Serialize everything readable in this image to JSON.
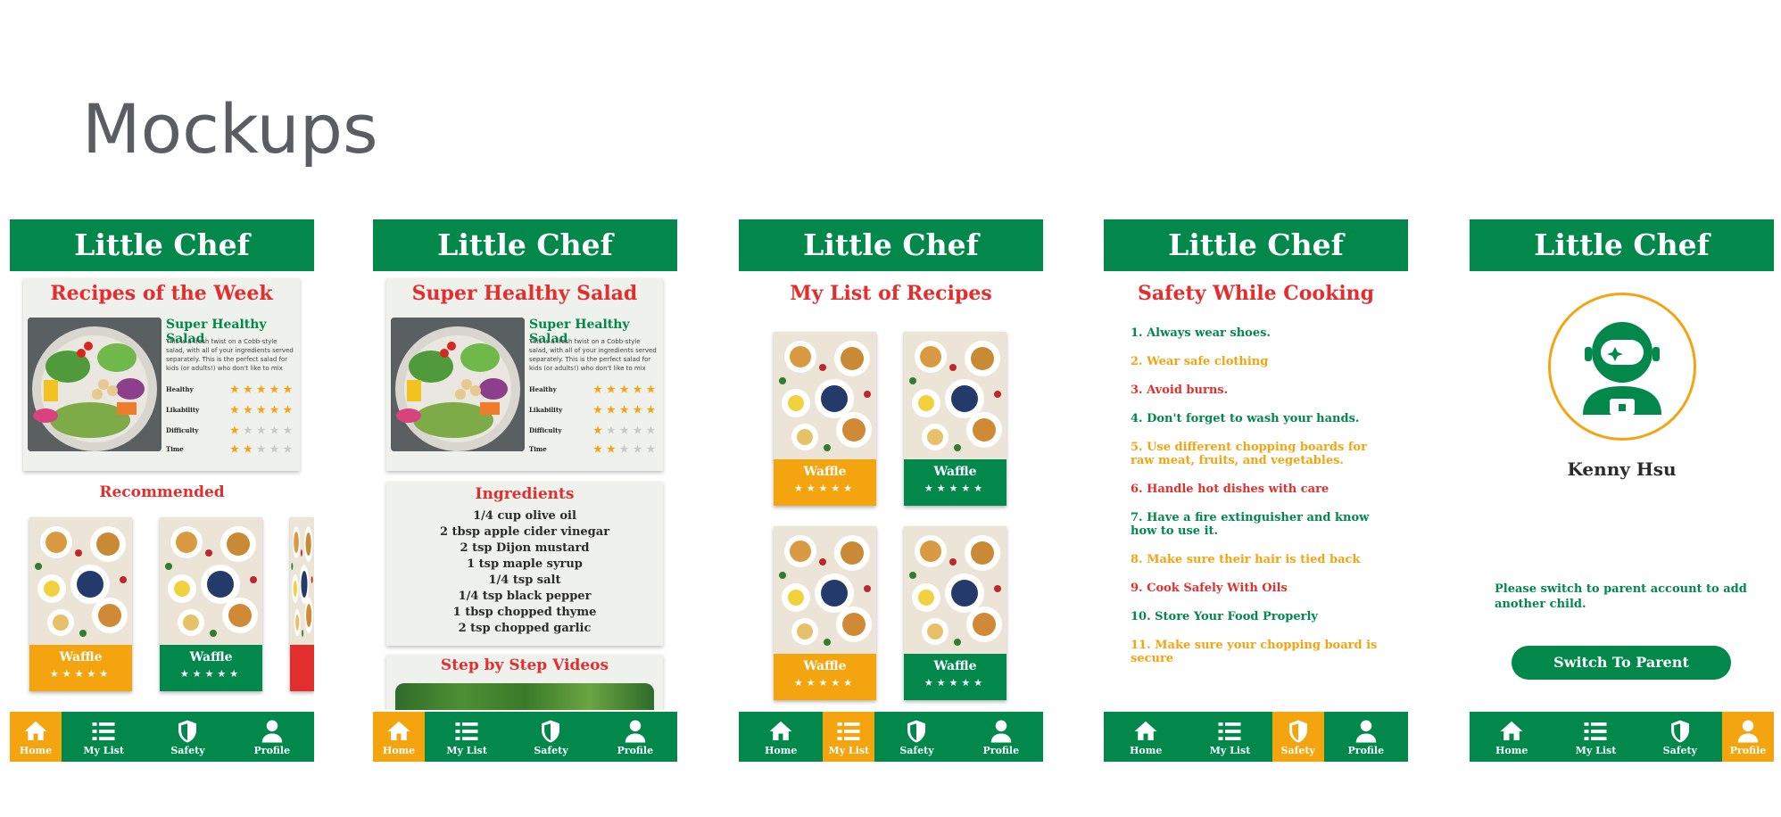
{
  "page": {
    "title": "Mockups"
  },
  "app": {
    "name": "Little Chef"
  },
  "colors": {
    "brand_green": "#01884a",
    "accent_orange": "#f4a40f",
    "title_red": "#e32e2e",
    "card_bg": "#eef1ec"
  },
  "nav": {
    "home": "Home",
    "list": "My List",
    "safety": "Safety",
    "profile": "Profile"
  },
  "screen1": {
    "heading": "Recipes of the Week",
    "recipe_name": "Super Healthy Salad",
    "recipe_desc": "This is a fresh twist on a Cobb-style salad, with all of your ingredients served separately. This is the perfect salad for kids (or adults!) who don't like to mix their",
    "ratings": [
      {
        "label": "Healthy",
        "value": 5
      },
      {
        "label": "Likability",
        "value": 5
      },
      {
        "label": "Difficulty",
        "value": 1
      },
      {
        "label": "Time",
        "value": 2
      }
    ],
    "recommended": "Recommended",
    "cards": [
      {
        "name": "Waffle",
        "stars": "★★★★★",
        "color": "#f4a40f"
      },
      {
        "name": "Waffle",
        "stars": "★★★★★",
        "color": "#01884a"
      }
    ]
  },
  "screen2": {
    "heading": "Super Healthy Salad",
    "recipe_name": "Super Healthy Salad",
    "recipe_desc": "This is a fresh twist on a Cobb-style salad, with all of your ingredients served separately. This is the perfect salad for kids (or adults!) who don't like to mix their",
    "ratings": [
      {
        "label": "Healthy",
        "value": 5
      },
      {
        "label": "Likability",
        "value": 5
      },
      {
        "label": "Difficulty",
        "value": 1
      },
      {
        "label": "Time",
        "value": 2
      }
    ],
    "ingredients_title": "Ingredients",
    "ingredients": [
      "1/4 cup olive oil",
      "2 tbsp apple cider vinegar",
      "2 tsp Dijon mustard",
      "1 tsp maple syrup",
      "1/4 tsp salt",
      "1/4 tsp black pepper",
      "1 tbsp chopped thyme",
      "2 tsp chopped garlic"
    ],
    "videos_title": "Step by Step Videos"
  },
  "screen3": {
    "heading": "My List of Recipes",
    "cards": [
      {
        "name": "Waffle",
        "stars": "★★★★★",
        "color": "#f4a40f"
      },
      {
        "name": "Waffle",
        "stars": "★★★★★",
        "color": "#01884a"
      },
      {
        "name": "Waffle",
        "stars": "★★★★★",
        "color": "#f4a40f"
      },
      {
        "name": "Waffle",
        "stars": "★★★★★",
        "color": "#01884a"
      }
    ]
  },
  "screen4": {
    "heading": "Safety While Cooking",
    "tips": [
      {
        "text": "1. Always wear shoes.",
        "color": "#01884a"
      },
      {
        "text": "2. Wear safe clothing",
        "color": "#f4a40f"
      },
      {
        "text": "3. Avoid burns.",
        "color": "#e32e2e"
      },
      {
        "text": "4. Don't forget to wash your hands.",
        "color": "#01884a"
      },
      {
        "text": "5. Use different chopping boards for raw meat, fruits, and vegetables.",
        "color": "#f4a40f"
      },
      {
        "text": "6. Handle hot dishes with care",
        "color": "#e32e2e"
      },
      {
        "text": "7. Have a fire extinguisher and know how to use it.",
        "color": "#01884a"
      },
      {
        "text": "8. Make sure their hair is tied back",
        "color": "#f4a40f"
      },
      {
        "text": "9. Cook Safely With Oils",
        "color": "#e32e2e"
      },
      {
        "text": "10. Store Your Food Properly",
        "color": "#01884a"
      },
      {
        "text": "11. Make sure your chopping board is secure",
        "color": "#f4a40f"
      }
    ]
  },
  "screen5": {
    "name": "Kenny Hsu",
    "note": "Please switch to parent account to add another child.",
    "button": "Switch To Parent"
  }
}
